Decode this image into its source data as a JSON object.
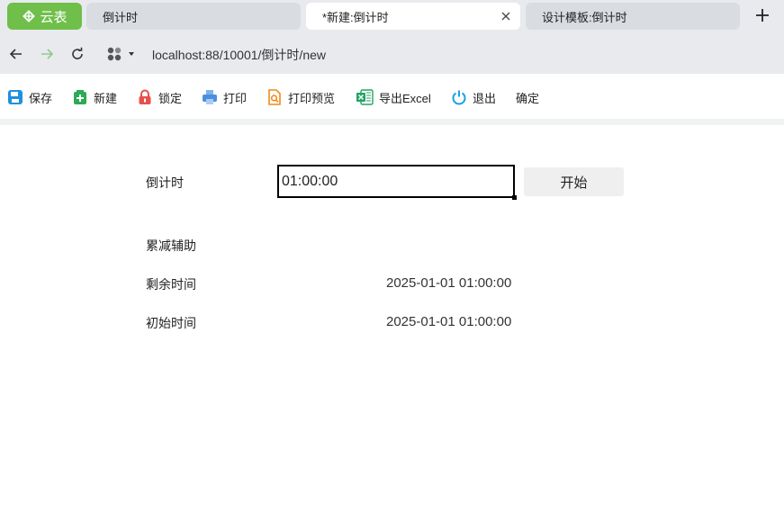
{
  "browser": {
    "brand_label": "云表",
    "tabs": [
      {
        "label": "倒计时"
      },
      {
        "label": "*新建:倒计时",
        "active": true
      },
      {
        "label": "设计模板:倒计时"
      }
    ],
    "url": "localhost:88/10001/倒计时/new"
  },
  "toolbar": {
    "items": [
      {
        "label": "保存",
        "icon": "save-icon",
        "color": "#1e90e0"
      },
      {
        "label": "新建",
        "icon": "new-doc-icon",
        "color": "#2eaa55"
      },
      {
        "label": "锁定",
        "icon": "lock-icon",
        "color": "#e8504a"
      },
      {
        "label": "打印",
        "icon": "printer-icon",
        "color": "#4a8fe0"
      },
      {
        "label": "打印预览",
        "icon": "print-preview-icon",
        "color": "#f08a1c"
      },
      {
        "label": "导出Excel",
        "icon": "excel-icon",
        "color": "#21a366"
      },
      {
        "label": "退出",
        "icon": "power-icon",
        "color": "#1aa0e8"
      },
      {
        "label": "确定"
      }
    ]
  },
  "form": {
    "countdown_label": "倒计时",
    "countdown_value": "01:00:00",
    "start_button": "开始",
    "decrement_label": "累减辅助",
    "remaining_label": "剩余时间",
    "remaining_value": "2025-01-01 01:00:00",
    "initial_label": "初始时间",
    "initial_value": "2025-01-01 01:00:00"
  }
}
